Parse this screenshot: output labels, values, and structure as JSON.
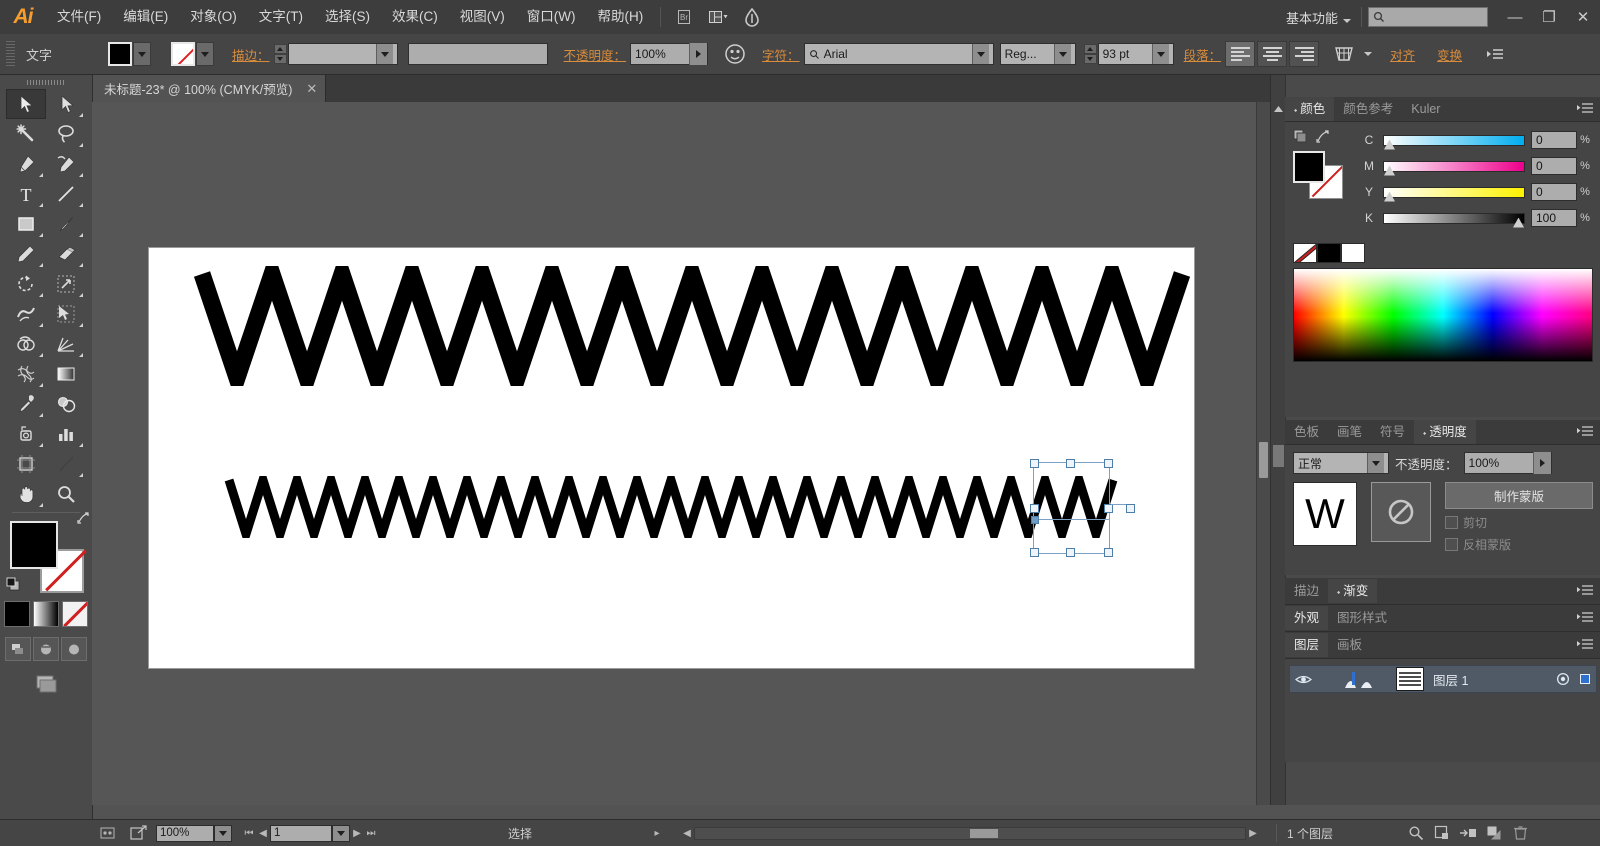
{
  "app": {
    "name": "Ai",
    "logo_text": "Ai"
  },
  "menubar": {
    "items": [
      "文件(F)",
      "编辑(E)",
      "对象(O)",
      "文字(T)",
      "选择(S)",
      "效果(C)",
      "视图(V)",
      "窗口(W)",
      "帮助(H)"
    ],
    "bridge_icon": "bridge-icon",
    "arrange_icon": "arrange-documents-icon",
    "arrange_caret": "▾",
    "stock_icon": "stock-icon",
    "workspace_label": "基本功能",
    "workspace_caret": "▾",
    "search_icon": "search-icon",
    "search_value": "",
    "window_minimize": "—",
    "window_restore": "❐",
    "window_close": "✕"
  },
  "controlbar": {
    "context_label": "文字",
    "fill_swatch_name": "fill-swatch",
    "fill_color": "#000000",
    "stroke_swatch_name": "stroke-swatch-none",
    "stroke_label": "描边：",
    "stroke_weight_value": "",
    "stroke_profile_value": "",
    "opacity_label": "不透明度：",
    "opacity_value": "100%",
    "opacity_flyout": "▸",
    "recolor_icon": "recolor-artwork-icon",
    "char_label": "字符：",
    "font_search_icon": "search-icon",
    "font_family": "Arial",
    "font_style": "Reg...",
    "font_size_value": "93 pt",
    "paragraph_label": "段落：",
    "align_left": "align-left",
    "align_center": "align-center",
    "align_right": "align-right",
    "envelope_icon": "envelope-distort-icon",
    "align_link": "对齐",
    "transform_link": "变换",
    "panel_menu_icon": "panel-menu-icon"
  },
  "tabbar": {
    "document_title": "未标题-23* @ 100% (CMYK/预览)",
    "close_glyph": "✕"
  },
  "toolbar": {
    "tools": [
      {
        "name": "selection-tool",
        "glyph": "selection",
        "active": true
      },
      {
        "name": "direct-selection-tool",
        "glyph": "direct-selection",
        "active": false
      },
      {
        "name": "magic-wand-tool",
        "glyph": "magic-wand",
        "active": false
      },
      {
        "name": "lasso-tool",
        "glyph": "lasso",
        "active": false
      },
      {
        "name": "pen-tool",
        "glyph": "pen",
        "active": false
      },
      {
        "name": "add-anchor-point-tool",
        "glyph": "pen-curve",
        "active": false
      },
      {
        "name": "type-tool",
        "glyph": "T",
        "active": false
      },
      {
        "name": "line-segment-tool",
        "glyph": "line",
        "active": false
      },
      {
        "name": "rectangle-tool",
        "glyph": "rectangle",
        "active": false
      },
      {
        "name": "paintbrush-tool",
        "glyph": "paintbrush",
        "active": false
      },
      {
        "name": "pencil-tool",
        "glyph": "pencil",
        "active": false
      },
      {
        "name": "blob-brush-tool",
        "glyph": "eraser",
        "active": false
      },
      {
        "name": "rotate-tool",
        "glyph": "rotate",
        "active": false
      },
      {
        "name": "scale-tool",
        "glyph": "scale",
        "active": false
      },
      {
        "name": "width-tool",
        "glyph": "warp",
        "active": false
      },
      {
        "name": "free-transform-tool",
        "glyph": "free-transform",
        "active": false
      },
      {
        "name": "shape-builder-tool",
        "glyph": "shape-builder",
        "active": false
      },
      {
        "name": "column-graph-tool",
        "glyph": "graph",
        "active": false
      },
      {
        "name": "mesh-tool",
        "glyph": "mesh",
        "active": false
      },
      {
        "name": "gradient-tool",
        "glyph": "gradient",
        "active": false
      },
      {
        "name": "eyedropper-tool",
        "glyph": "eyedropper",
        "active": false
      },
      {
        "name": "blend-tool",
        "glyph": "blend",
        "active": false
      },
      {
        "name": "symbol-sprayer-tool",
        "glyph": "symbol-sprayer",
        "active": false
      },
      {
        "name": "bar-graph-tool",
        "glyph": "bar-graph",
        "active": false
      },
      {
        "name": "artboard-tool",
        "glyph": "artboard",
        "active": false
      },
      {
        "name": "slice-tool",
        "glyph": "slice",
        "active": false
      },
      {
        "name": "hand-tool",
        "glyph": "hand",
        "active": false
      },
      {
        "name": "zoom-tool",
        "glyph": "zoom",
        "active": false
      }
    ],
    "fill_color": "#000000",
    "stroke_color": "none",
    "swap_icon": "swap-fill-stroke-icon",
    "default_icon": "default-fill-stroke-icon",
    "color_mode_icon": "color-mode",
    "gradient_mode_icon": "gradient-mode",
    "none_mode_icon": "none-mode",
    "screen_modes": [
      "normal-screen-mode",
      "full-screen-menubar-mode",
      "full-screen-mode"
    ],
    "drawing_mode_icon": "drawing-mode-icon"
  },
  "canvas": {
    "artboard_bg": "#ffffff",
    "artwork": [
      {
        "name": "zigzag-row-large",
        "text": "WWWWWWWWWWWW",
        "peaks": 12,
        "color": "#000000"
      },
      {
        "name": "zigzag-row-small",
        "text": "WWWWWWWWWWWWWWWWWWWWWWWW",
        "peaks": 24,
        "color": "#000000"
      }
    ],
    "selection": {
      "name": "selection-bounding-box",
      "color": "#7ba2c4"
    }
  },
  "panels": {
    "color": {
      "tabs": [
        "颜色",
        "颜色参考",
        "Kuler"
      ],
      "selected_tab": "颜色",
      "sliders": [
        {
          "label": "C",
          "value": "0",
          "unit": "%",
          "pos": 0
        },
        {
          "label": "M",
          "value": "0",
          "unit": "%",
          "pos": 0
        },
        {
          "label": "Y",
          "value": "0",
          "unit": "%",
          "pos": 0
        },
        {
          "label": "K",
          "value": "100",
          "unit": "%",
          "pos": 100
        }
      ],
      "fill_color": "#000000",
      "mini_swatches": [
        "none",
        "#000000",
        "#ffffff"
      ]
    },
    "transparency": {
      "tabs": [
        "色板",
        "画笔",
        "符号",
        "透明度"
      ],
      "selected_tab": "透明度",
      "blend_mode": "正常",
      "opacity_label": "不透明度：",
      "opacity_value": "100%",
      "thumb_text": "W",
      "mask_icon": "no-mask-icon",
      "make_mask_button": "制作蒙版",
      "clip_label": "剪切",
      "invert_label": "反相蒙版"
    },
    "stroke_gradient": {
      "tabs": [
        "描边",
        "渐变"
      ],
      "selected_tab": "渐变"
    },
    "appearance": {
      "tabs": [
        "外观",
        "图形样式"
      ],
      "selected_tab": "外观"
    },
    "layers": {
      "tabs": [
        "图层",
        "画板"
      ],
      "selected_tab": "图层",
      "rows": [
        {
          "name": "图层 1",
          "visible": true,
          "eye_icon": "eye-icon",
          "target_icon": "target-icon",
          "selected_color": "#2f6fd0"
        }
      ]
    }
  },
  "statusbar": {
    "artboard_nav_icon": "artboard-navigation-icon",
    "export_icon": "export-icon",
    "zoom_value": "100%",
    "first_icon": "first-artboard-icon",
    "prev_icon": "prev-artboard-icon",
    "artboard_number": "1",
    "next_icon": "next-artboard-icon",
    "last_icon": "last-artboard-icon",
    "status_text": "选择",
    "status_flyout": "▸",
    "layers_count": "1 个图层",
    "right_icons": [
      "search-layer-icon",
      "new-sublayer-icon",
      "new-layer-icon",
      "duplicate-icon",
      "delete-layer-icon"
    ]
  }
}
